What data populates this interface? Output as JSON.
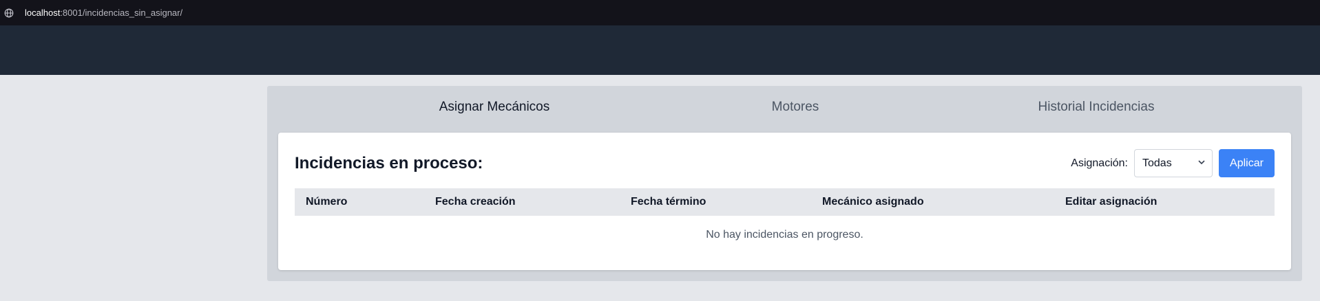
{
  "browser": {
    "url_host": "localhost",
    "url_rest": ":8001/incidencias_sin_asignar/",
    "icon": "globe-icon"
  },
  "tabs": [
    {
      "label": "Asignar Mecánicos",
      "active": true
    },
    {
      "label": "Motores",
      "active": false
    },
    {
      "label": "Historial Incidencias",
      "active": false
    }
  ],
  "card": {
    "title": "Incidencias en proceso:",
    "filter_label": "Asignación:",
    "filter_value": "Todas",
    "apply_label": "Aplicar"
  },
  "table": {
    "headers": [
      "Número",
      "Fecha creación",
      "Fecha término",
      "Mecánico asignado",
      "Editar asignación"
    ],
    "empty_message": "No hay incidencias en progreso."
  },
  "colors": {
    "accent": "#3b82f6",
    "navbar": "#1f2937",
    "page_bg": "#e5e7eb"
  }
}
